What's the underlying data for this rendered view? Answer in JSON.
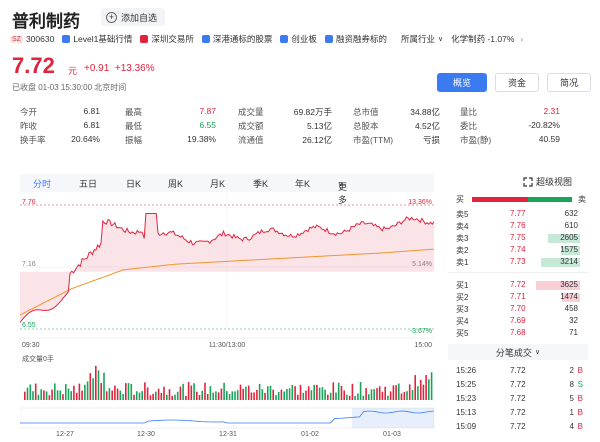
{
  "stock": {
    "name": "普利制药",
    "fav_label": "添加自选",
    "market_badge": "SZ",
    "code": "300630",
    "tags": [
      {
        "label": "Level1基础行情",
        "color": "#3a7bf2"
      },
      {
        "label": "深圳交易所",
        "color": "#e2233e"
      },
      {
        "label": "深港通标的股票",
        "color": "#3a7bf2"
      },
      {
        "label": "创业板",
        "color": "#3a7bf2"
      },
      {
        "label": "融资融券标的",
        "color": "#3a7bf2"
      }
    ],
    "industry_label": "所属行业",
    "industry_chevron": "∨",
    "industry_value": "化学制药 -1.07%",
    "industry_arrow": "›",
    "price": "7.72",
    "price_unit": "元",
    "change": "+0.91",
    "change_pct": "+13.36%",
    "status": "已收盘  01-03 15:30:00 北京时间"
  },
  "view_tabs": [
    {
      "label": "概览",
      "active": true
    },
    {
      "label": "资金",
      "active": false
    },
    {
      "label": "简况",
      "active": false
    }
  ],
  "stats": [
    [
      {
        "label": "今开",
        "value": "6.81",
        "color": ""
      },
      {
        "label": "最高",
        "value": "7.87",
        "color": "red"
      },
      {
        "label": "成交量",
        "value": "69.82万手",
        "color": ""
      },
      {
        "label": "总市值",
        "value": "34.88亿",
        "color": ""
      },
      {
        "label": "量比",
        "value": "2.31",
        "color": "red"
      }
    ],
    [
      {
        "label": "昨收",
        "value": "6.81",
        "color": ""
      },
      {
        "label": "最低",
        "value": "6.55",
        "color": "green"
      },
      {
        "label": "成交额",
        "value": "5.13亿",
        "color": ""
      },
      {
        "label": "总股本",
        "value": "4.52亿",
        "color": ""
      },
      {
        "label": "委比",
        "value": "-20.82%",
        "color": ""
      }
    ],
    [
      {
        "label": "换手率",
        "value": "20.64%",
        "color": ""
      },
      {
        "label": "振幅",
        "value": "19.38%",
        "color": ""
      },
      {
        "label": "流通值",
        "value": "26.12亿",
        "color": ""
      },
      {
        "label": "市盈(TTM)",
        "value": "亏损",
        "color": ""
      },
      {
        "label": "市盈(静)",
        "value": "40.59",
        "color": ""
      }
    ]
  ],
  "periods": [
    "分时",
    "五日",
    "日K",
    "周K",
    "月K",
    "季K",
    "年K",
    "更多"
  ],
  "period_more_chevron": "∨",
  "super_chart_label": "超级视图",
  "chart": {
    "price_labels": {
      "high": "7.76",
      "mid": "7.16",
      "low": "6.55"
    },
    "pct_labels": {
      "high": "13.36%",
      "mid": "5.14%",
      "low": "-3.67%"
    },
    "time_labels": [
      "09:30",
      "11:30/13:00",
      "15:00"
    ],
    "volume_label": "成交量0手",
    "date_labels": [
      "12-27",
      "12-30",
      "12-31",
      "01-02",
      "01-03"
    ]
  },
  "chart_data": {
    "type": "line",
    "x": [
      "09:30",
      "10:00",
      "10:30",
      "11:00",
      "11:30/13:00",
      "13:30",
      "14:00",
      "14:30",
      "15:00"
    ],
    "series": [
      {
        "values": [
          6.65,
          7.16,
          7.7,
          7.55,
          7.53,
          7.58,
          7.6,
          7.65,
          7.72
        ]
      },
      {
        "values": [
          6.7,
          6.98,
          7.18,
          7.24,
          7.27,
          7.3,
          7.33,
          7.36,
          7.4
        ]
      }
    ],
    "ylim": [
      6.55,
      7.87
    ]
  },
  "orderbook": {
    "sell_label": "买",
    "buy_label": "卖",
    "asks": [
      {
        "label": "卖5",
        "price": "7.77",
        "vol": "632",
        "bar": 0
      },
      {
        "label": "卖4",
        "price": "7.76",
        "vol": "610",
        "bar": 0
      },
      {
        "label": "卖3",
        "price": "7.75",
        "vol": "2605",
        "bar": 0.72
      },
      {
        "label": "卖2",
        "price": "7.74",
        "vol": "1575",
        "bar": 0.43
      },
      {
        "label": "卖1",
        "price": "7.73",
        "vol": "3214",
        "bar": 0.89
      }
    ],
    "bids": [
      {
        "label": "买1",
        "price": "7.72",
        "vol": "3625",
        "bar": 1.0
      },
      {
        "label": "买2",
        "price": "7.71",
        "vol": "1474",
        "bar": 0.41
      },
      {
        "label": "买3",
        "price": "7.70",
        "vol": "458",
        "bar": 0
      },
      {
        "label": "买4",
        "price": "7.69",
        "vol": "32",
        "bar": 0
      },
      {
        "label": "买5",
        "price": "7.68",
        "vol": "71",
        "bar": 0
      }
    ]
  },
  "trades_title": "分笔成交",
  "trades_chevron": "∨",
  "trades": [
    {
      "time": "15:26",
      "price": "7.72",
      "vol": "2",
      "dir": "B"
    },
    {
      "time": "15:25",
      "price": "7.72",
      "vol": "8",
      "dir": "S"
    },
    {
      "time": "15:23",
      "price": "7.72",
      "vol": "5",
      "dir": "B"
    },
    {
      "time": "15:13",
      "price": "7.72",
      "vol": "1",
      "dir": "B"
    },
    {
      "time": "15:09",
      "price": "7.72",
      "vol": "4",
      "dir": "B"
    }
  ],
  "colors": {
    "up": "#e2233e",
    "down": "#1aa35b",
    "accent": "#3a7bf2",
    "avg": "#f29430"
  }
}
